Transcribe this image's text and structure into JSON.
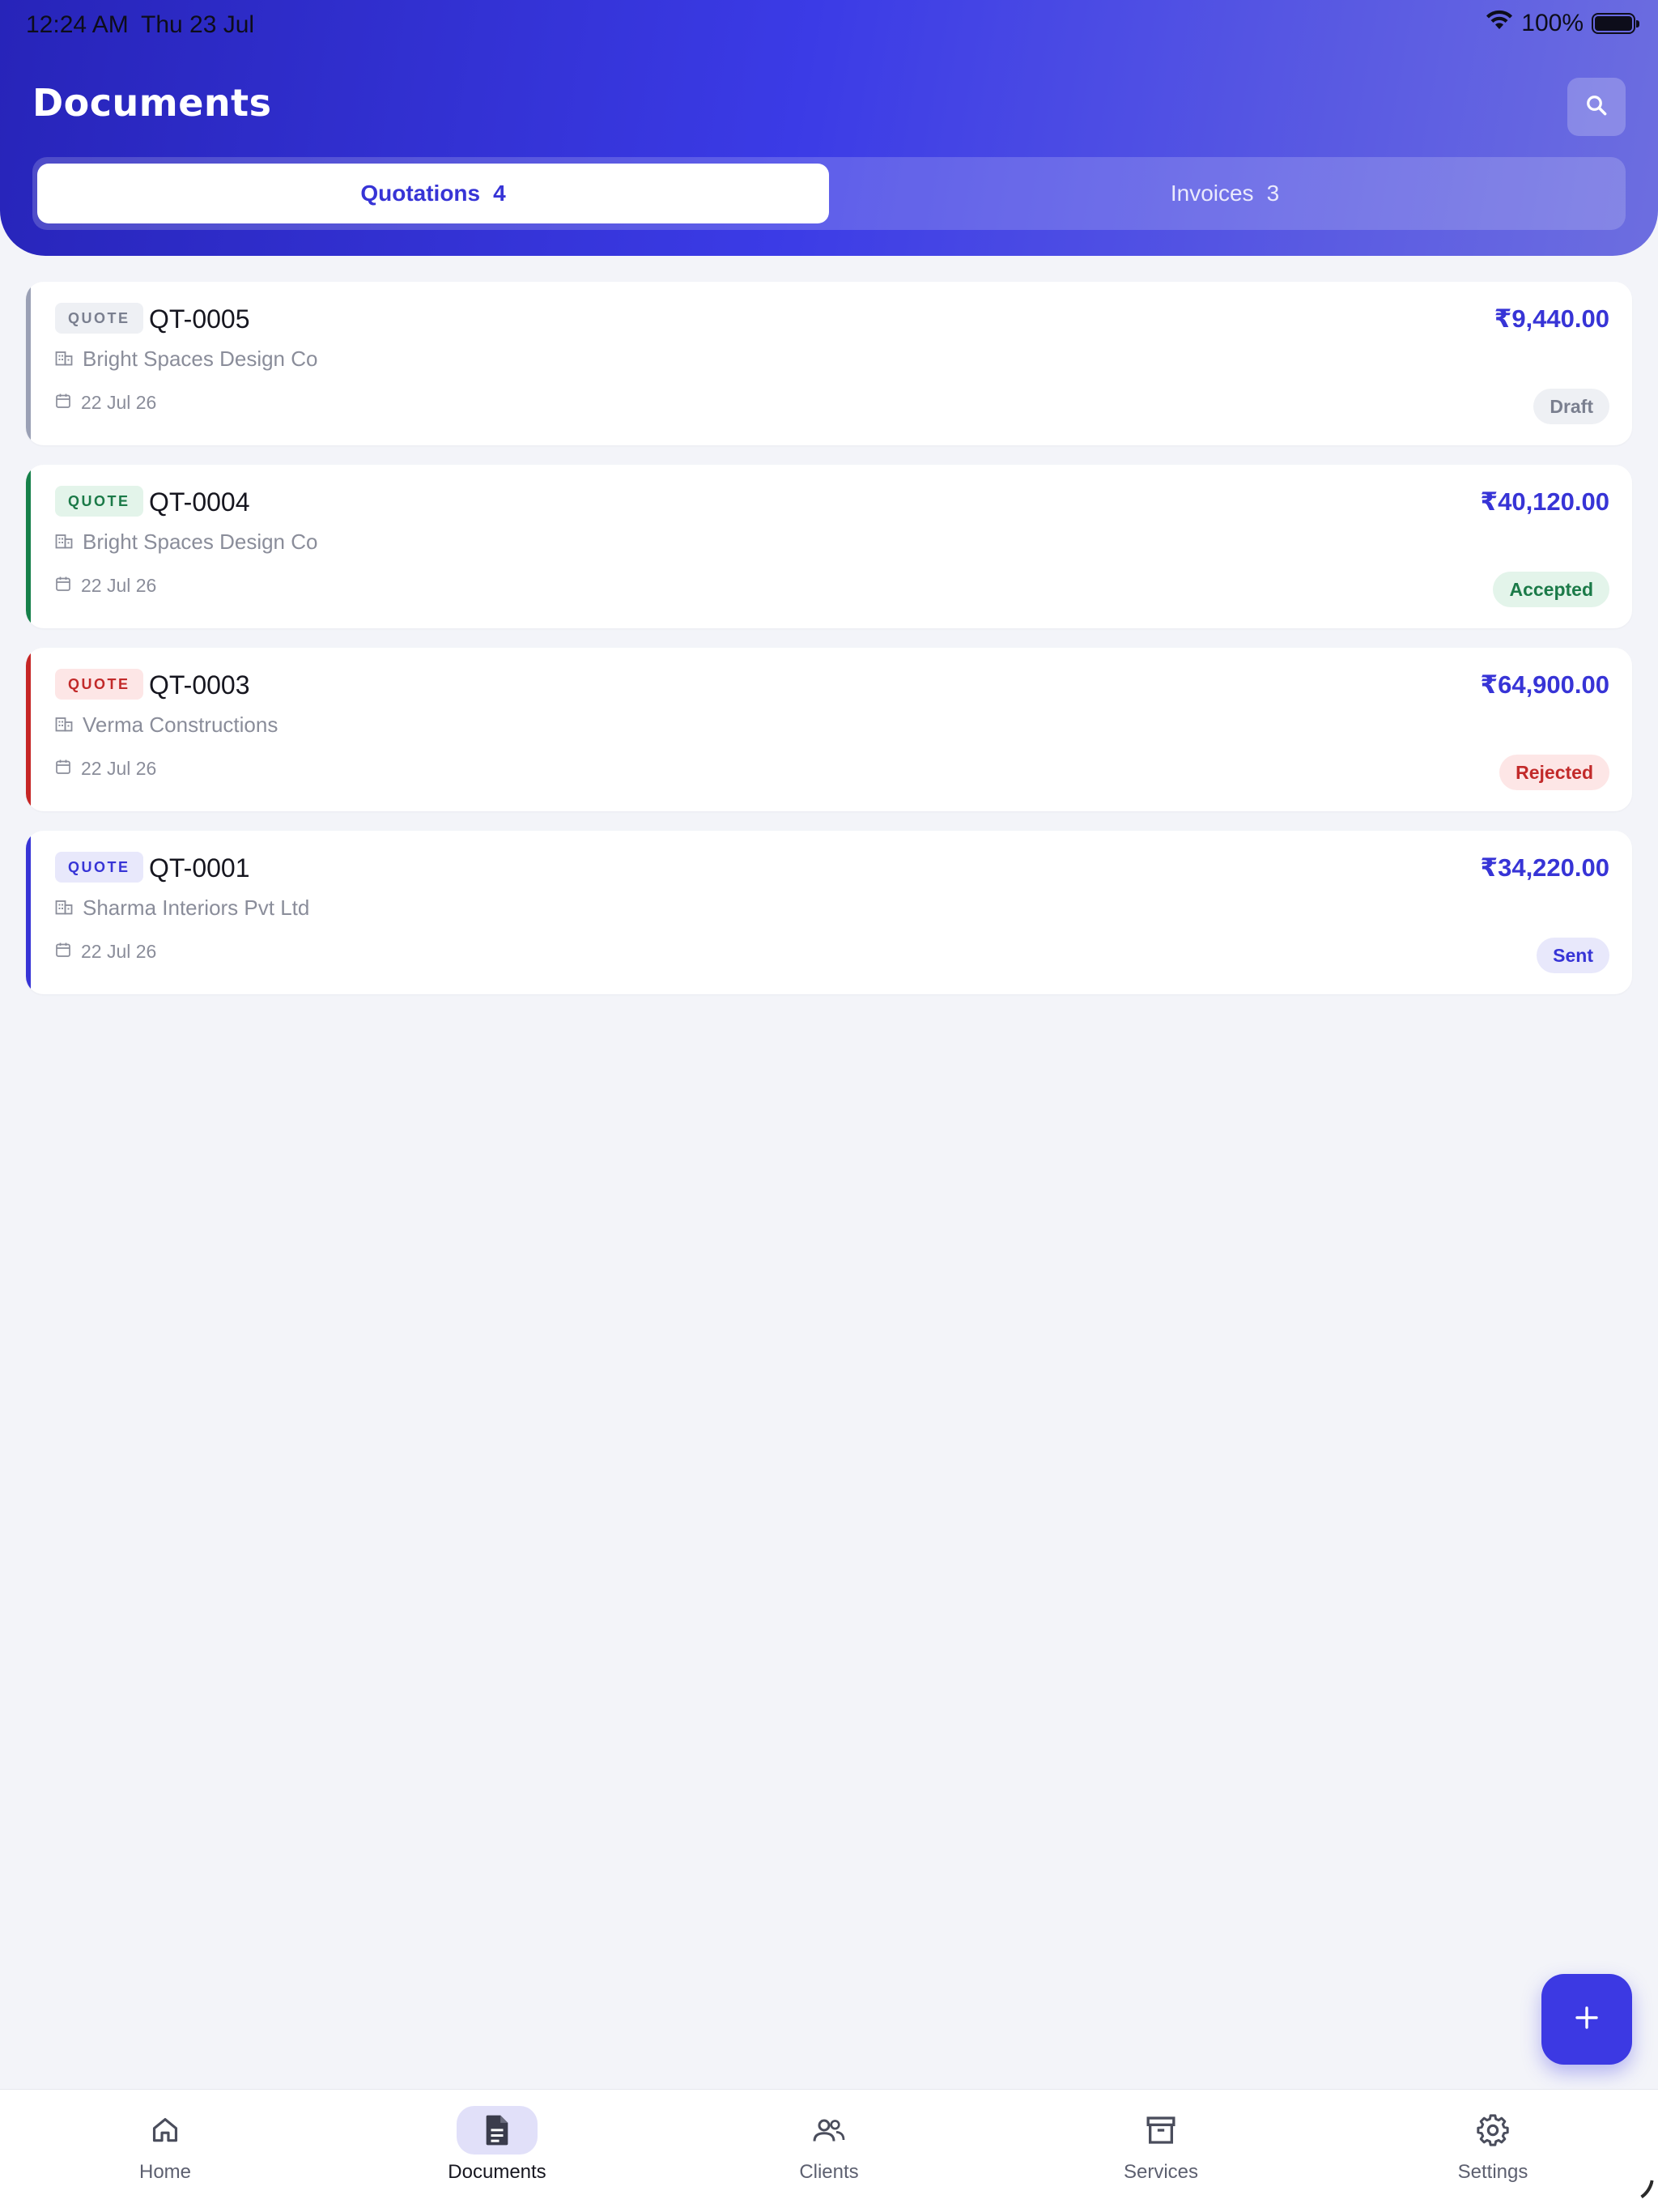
{
  "status_bar": {
    "time": "12:24 AM",
    "date": "Thu 23 Jul",
    "battery": "100%"
  },
  "header": {
    "title": "Documents",
    "search_icon": "search-icon",
    "tabs": [
      {
        "label": "Quotations",
        "count": "4",
        "active": true
      },
      {
        "label": "Invoices",
        "count": "3",
        "active": false
      }
    ]
  },
  "documents": [
    {
      "badge": "QUOTE",
      "number": "QT-0005",
      "client": "Bright Spaces Design Co",
      "date": "22 Jul 26",
      "amount": "₹9,440.00",
      "status": "Draft",
      "accent": "#9aa0b5",
      "badge_bg": "#eef0f4",
      "badge_fg": "#7a7f8f",
      "pill_bg": "#eef0f4",
      "pill_fg": "#7a7f8f"
    },
    {
      "badge": "QUOTE",
      "number": "QT-0004",
      "client": "Bright Spaces Design Co",
      "date": "22 Jul 26",
      "amount": "₹40,120.00",
      "status": "Accepted",
      "accent": "#16804a",
      "badge_bg": "#e3f4ea",
      "badge_fg": "#1b7a48",
      "pill_bg": "#e3f4ea",
      "pill_fg": "#1b7a48"
    },
    {
      "badge": "QUOTE",
      "number": "QT-0003",
      "client": "Verma Constructions",
      "date": "22 Jul 26",
      "amount": "₹64,900.00",
      "status": "Rejected",
      "accent": "#c62626",
      "badge_bg": "#fde6e6",
      "badge_fg": "#c22a2a",
      "pill_bg": "#fde6e6",
      "pill_fg": "#c22a2a"
    },
    {
      "badge": "QUOTE",
      "number": "QT-0001",
      "client": "Sharma Interiors Pvt Ltd",
      "date": "22 Jul 26",
      "amount": "₹34,220.00",
      "status": "Sent",
      "accent": "#3734d6",
      "badge_bg": "#e8e8fb",
      "badge_fg": "#3734d6",
      "pill_bg": "#e8e8fb",
      "pill_fg": "#3734d6"
    }
  ],
  "fab": {
    "icon": "plus-icon"
  },
  "bottom_nav": [
    {
      "label": "Home",
      "icon": "home-icon",
      "active": false
    },
    {
      "label": "Documents",
      "icon": "document-icon",
      "active": true
    },
    {
      "label": "Clients",
      "icon": "clients-icon",
      "active": false
    },
    {
      "label": "Services",
      "icon": "archive-icon",
      "active": false
    },
    {
      "label": "Settings",
      "icon": "gear-icon",
      "active": false
    }
  ],
  "colors": {
    "primary": "#3734d6",
    "header_gradient_start": "#2724b9",
    "header_gradient_end": "#6d6ee0",
    "background": "#f3f4f9"
  }
}
